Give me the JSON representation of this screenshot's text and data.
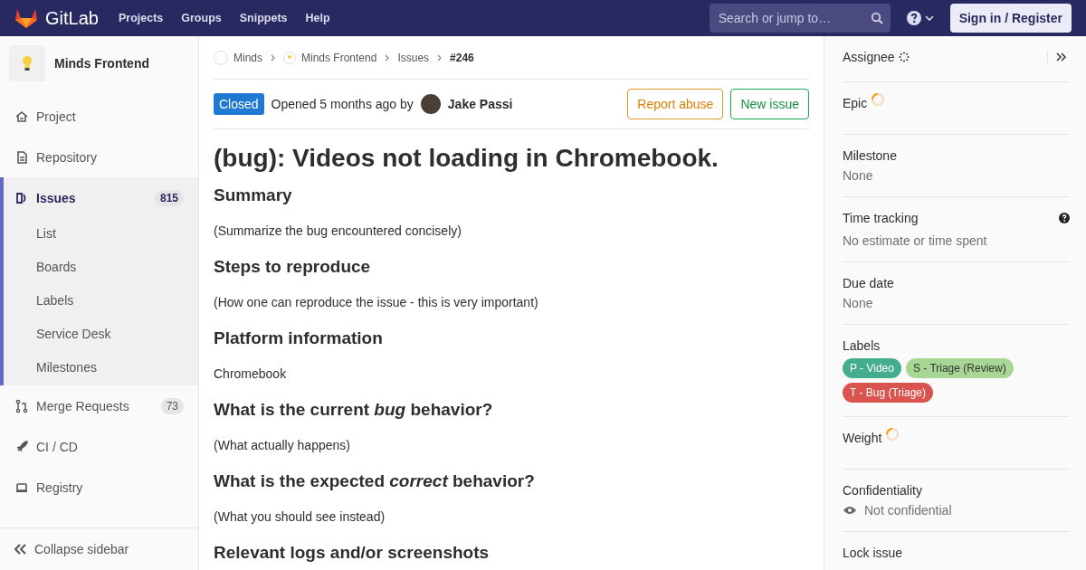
{
  "header": {
    "logo": "GitLab",
    "nav": [
      "Projects",
      "Groups",
      "Snippets",
      "Help"
    ],
    "search": {
      "placeholder": "Search or jump to…"
    },
    "sign_in": "Sign in / Register"
  },
  "sidebar": {
    "project": "Minds Frontend",
    "items": [
      {
        "label": "Project",
        "selected": false
      },
      {
        "label": "Repository",
        "selected": false
      },
      {
        "label": "Issues",
        "selected": true,
        "count": "815",
        "children": [
          "List",
          "Boards",
          "Labels",
          "Service Desk",
          "Milestones"
        ]
      },
      {
        "label": "Merge Requests",
        "selected": false,
        "count": "73"
      },
      {
        "label": "CI / CD",
        "selected": false
      },
      {
        "label": "Registry",
        "selected": false
      }
    ],
    "collapse": "Collapse sidebar"
  },
  "breadcrumbs": [
    "Minds",
    "Minds Frontend",
    "Issues",
    "#246"
  ],
  "issue": {
    "status": "Closed",
    "opened": "Opened 5 months ago by",
    "author": "Jake Passi",
    "buttons": [
      {
        "label": "Report abuse",
        "kind": "warning"
      },
      {
        "label": "New issue",
        "kind": "success"
      }
    ],
    "title": "(bug): Videos not loading in Chromebook.",
    "body": [
      {
        "kind": "heading",
        "text": "Summary"
      },
      {
        "kind": "paragraph",
        "text": "(Summarize the bug encountered concisely)"
      },
      {
        "kind": "heading",
        "text": "Steps to reproduce"
      },
      {
        "kind": "paragraph",
        "text": "(How one can reproduce the issue - this is very important)"
      },
      {
        "kind": "heading",
        "text": "Platform information"
      },
      {
        "kind": "paragraph",
        "text": "Chromebook"
      },
      {
        "kind": "heading",
        "text": "What is the current *bug* behavior?"
      },
      {
        "kind": "paragraph",
        "text": "(What actually happens)"
      },
      {
        "kind": "heading",
        "text": "What is the expected *correct* behavior?"
      },
      {
        "kind": "paragraph",
        "text": "(What you should see instead)"
      },
      {
        "kind": "heading",
        "text": "Relevant logs and/or screenshots"
      }
    ]
  },
  "right_sidebar": [
    {
      "title": "Assignee",
      "kind": "dots"
    },
    {
      "title": "Epic",
      "kind": "ring"
    },
    {
      "title": "Milestone",
      "kind": "value",
      "value": "None"
    },
    {
      "title": "Time tracking",
      "kind": "help",
      "value": "No estimate or time spent"
    },
    {
      "title": "Due date",
      "kind": "value",
      "value": "None"
    },
    {
      "title": "Labels",
      "kind": "labels",
      "labels": [
        {
          "text": "P - Video",
          "color": "#44ad8e"
        },
        {
          "text": "S - Triage (Review)",
          "color": "#a8d695"
        },
        {
          "text": "T - Bug (Triage)",
          "color": "#d9534f"
        }
      ]
    },
    {
      "title": "Weight",
      "kind": "ring"
    },
    {
      "title": "Confidentiality",
      "kind": "eye",
      "value": "Not confidential"
    },
    {
      "title": "Lock issue",
      "kind": "title"
    }
  ]
}
